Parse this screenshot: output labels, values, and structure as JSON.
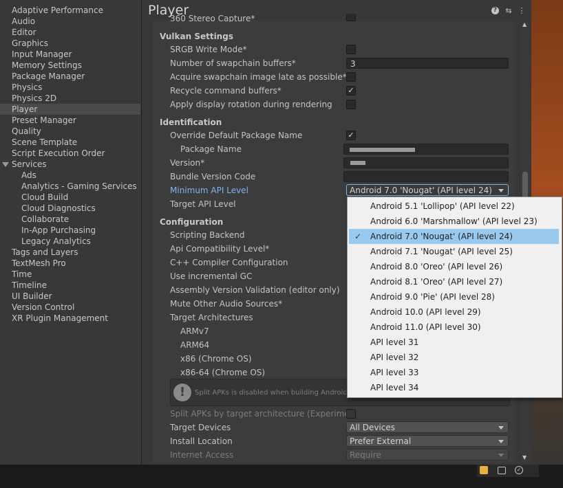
{
  "sidebar": {
    "items": [
      {
        "label": "Adaptive Performance"
      },
      {
        "label": "Audio"
      },
      {
        "label": "Editor"
      },
      {
        "label": "Graphics"
      },
      {
        "label": "Input Manager"
      },
      {
        "label": "Memory Settings"
      },
      {
        "label": "Package Manager"
      },
      {
        "label": "Physics"
      },
      {
        "label": "Physics 2D"
      },
      {
        "label": "Player",
        "selected": true
      },
      {
        "label": "Preset Manager"
      },
      {
        "label": "Quality"
      },
      {
        "label": "Scene Template"
      },
      {
        "label": "Script Execution Order"
      },
      {
        "label": "Services",
        "expanded": true
      },
      {
        "label": "Ads"
      },
      {
        "label": "Analytics - Gaming Services"
      },
      {
        "label": "Cloud Build"
      },
      {
        "label": "Cloud Diagnostics"
      },
      {
        "label": "Collaborate"
      },
      {
        "label": "In-App Purchasing"
      },
      {
        "label": "Legacy Analytics"
      },
      {
        "label": "Tags and Layers"
      },
      {
        "label": "TextMesh Pro"
      },
      {
        "label": "Time"
      },
      {
        "label": "Timeline"
      },
      {
        "label": "UI Builder"
      },
      {
        "label": "Version Control"
      },
      {
        "label": "XR Plugin Management"
      }
    ]
  },
  "header": {
    "title": "Player",
    "icons": [
      "help-icon",
      "settings-sliders-icon",
      "more-options-icon"
    ]
  },
  "vulkan": {
    "cut_label": "360 Stereo Capture*",
    "heading": "Vulkan Settings",
    "srgb_label": "SRGB Write Mode*",
    "swapchain_label": "Number of swapchain buffers*",
    "swapchain_value": "3",
    "acquire_label": "Acquire swapchain image late as possible*",
    "recycle_label": "Recycle command buffers*",
    "rotation_label": "Apply display rotation during rendering"
  },
  "identification": {
    "heading": "Identification",
    "override_label": "Override Default Package Name",
    "package_label": "Package Name",
    "version_label": "Version*",
    "bundle_label": "Bundle Version Code",
    "min_api_label": "Minimum API Level",
    "min_api_value": "Android 7.0 'Nougat' (API level 24)",
    "target_api_label": "Target API Level"
  },
  "configuration": {
    "heading": "Configuration",
    "scripting_backend": "Scripting Backend",
    "api_compat": "Api Compatibility Level*",
    "cpp_compiler": "C++ Compiler Configuration",
    "incremental_gc": "Use incremental GC",
    "assembly_validation": "Assembly Version Validation (editor only)",
    "mute_audio": "Mute Other Audio Sources*",
    "target_arch": "Target Architectures",
    "armv7": "ARMv7",
    "arm64": "ARM64",
    "x86": "x86 (Chrome OS)",
    "x86_64": "x86-64 (Chrome OS)",
    "hint_text": "Split APKs is disabled when building Android App Bundle",
    "split_apks": "Split APKs by target architecture (Experimental)",
    "target_devices_label": "Target Devices",
    "target_devices_value": "All Devices",
    "install_location_label": "Install Location",
    "install_location_value": "Prefer External",
    "internet_access_label": "Internet Access",
    "internet_access_value": "Require"
  },
  "api_popup": {
    "options": [
      {
        "label": "Android 5.1 'Lollipop' (API level 22)"
      },
      {
        "label": "Android 6.0 'Marshmallow' (API level 23)"
      },
      {
        "label": "Android 7.0 'Nougat' (API level 24)",
        "selected": true
      },
      {
        "label": "Android 7.1 'Nougat' (API level 25)"
      },
      {
        "label": "Android 8.0 'Oreo' (API level 26)"
      },
      {
        "label": "Android 8.1 'Oreo' (API level 27)"
      },
      {
        "label": "Android 9.0 'Pie' (API level 28)"
      },
      {
        "label": "Android 10.0 (API level 29)"
      },
      {
        "label": "Android 11.0 (API level 30)"
      },
      {
        "label": "API level 31"
      },
      {
        "label": "API level 32"
      },
      {
        "label": "API level 33"
      },
      {
        "label": "API level 34"
      }
    ]
  },
  "glyphs": {
    "check": "✓",
    "help": "?",
    "sliders": "⇆",
    "more": "⋮",
    "warning": "!",
    "scroll_up": "▲",
    "scroll_down": "▼"
  }
}
